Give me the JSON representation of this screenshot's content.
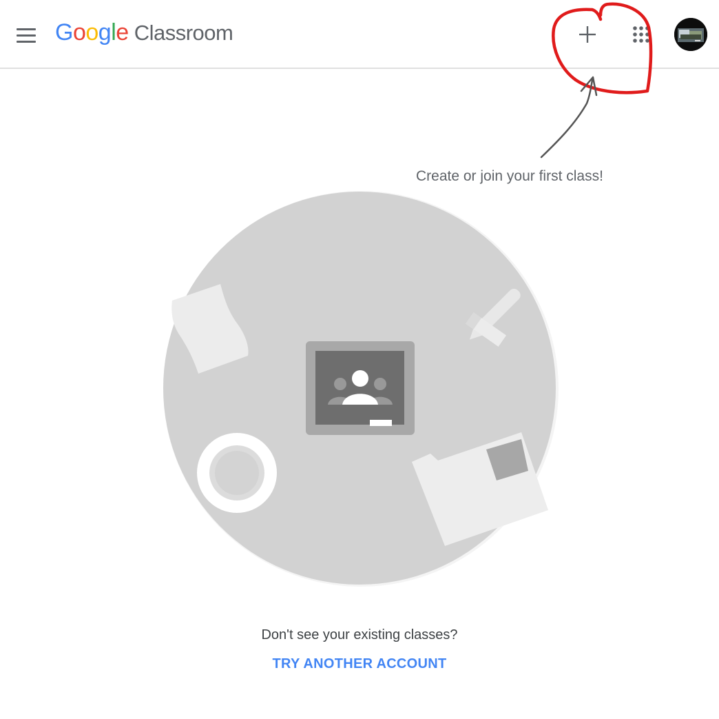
{
  "header": {
    "logo_letters": [
      {
        "char": "G",
        "color": "#4285F4"
      },
      {
        "char": "o",
        "color": "#EA4335"
      },
      {
        "char": "o",
        "color": "#FBBC05"
      },
      {
        "char": "g",
        "color": "#4285F4"
      },
      {
        "char": "l",
        "color": "#34A853"
      },
      {
        "char": "e",
        "color": "#EA4335"
      }
    ],
    "product_name": "Classroom",
    "icons": {
      "menu": "hamburger-menu-icon",
      "create": "plus-icon",
      "apps": "apps-grid-icon",
      "account": "account-avatar"
    }
  },
  "empty_state": {
    "hint": "Create or join your first class!",
    "question": "Don't see your existing classes?",
    "link_label": "TRY ANOTHER ACCOUNT",
    "illustration_icon": "classroom-board-icon"
  },
  "annotation": {
    "color": "#e01b1b",
    "arrow_color": "#555555"
  },
  "colors": {
    "link": "#4285f4",
    "text_secondary": "#5f6368",
    "illustration_circle": "#d2d2d2"
  }
}
